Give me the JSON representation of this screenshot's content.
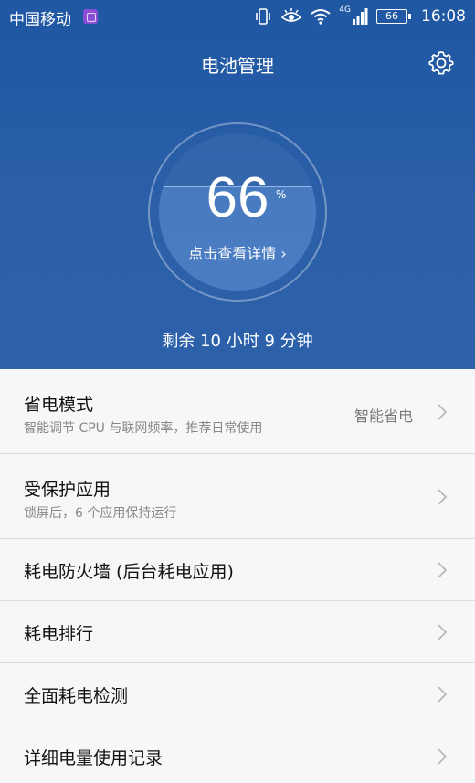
{
  "status_bar": {
    "carrier": "中国移动",
    "network": "4G",
    "battery_level": "66",
    "time": "16:08"
  },
  "header": {
    "title": "电池管理",
    "settings_icon": "gear-icon"
  },
  "battery": {
    "percent_value": "66",
    "percent_sign": "%",
    "percent_fraction": 0.66,
    "details_link": "点击查看详情 ›",
    "remaining_text": "剩余 10 小时 9 分钟"
  },
  "menu": [
    {
      "title": "省电模式",
      "subtitle": "智能调节 CPU 与联网频率，推荐日常使用",
      "value": "智能省电"
    },
    {
      "title": "受保护应用",
      "subtitle": "锁屏后，6 个应用保持运行"
    },
    {
      "title": "耗电防火墙 (后台耗电应用)"
    },
    {
      "title": "耗电排行"
    },
    {
      "title": "全面耗电检测"
    },
    {
      "title": "详细电量使用记录"
    }
  ],
  "colors": {
    "header_bg": "#2b5fa8",
    "list_bg": "#f7f7f7"
  }
}
